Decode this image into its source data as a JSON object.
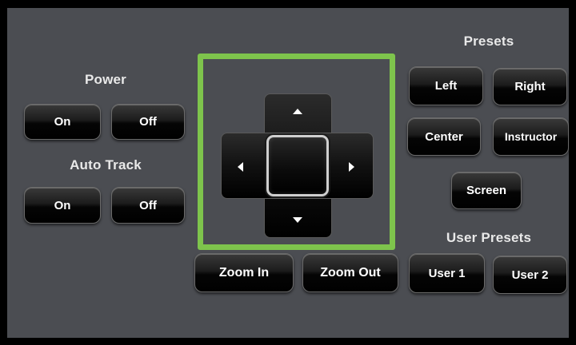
{
  "power": {
    "title": "Power",
    "on_label": "On",
    "off_label": "Off"
  },
  "auto_track": {
    "title": "Auto Track",
    "on_label": "On",
    "off_label": "Off"
  },
  "zoom": {
    "in_label": "Zoom In",
    "out_label": "Zoom Out"
  },
  "presets": {
    "title": "Presets",
    "left_label": "Left",
    "right_label": "Right",
    "center_label": "Center",
    "instructor_label": "Instructor",
    "screen_label": "Screen"
  },
  "user_presets": {
    "title": "User Presets",
    "user1_label": "User 1",
    "user2_label": "User 2"
  },
  "colors": {
    "highlight": "#7ec44c",
    "panel": "#4b4d52",
    "button": "#000000"
  },
  "icons": [
    "arrow-up-icon",
    "arrow-down-icon",
    "arrow-left-icon",
    "arrow-right-icon"
  ]
}
